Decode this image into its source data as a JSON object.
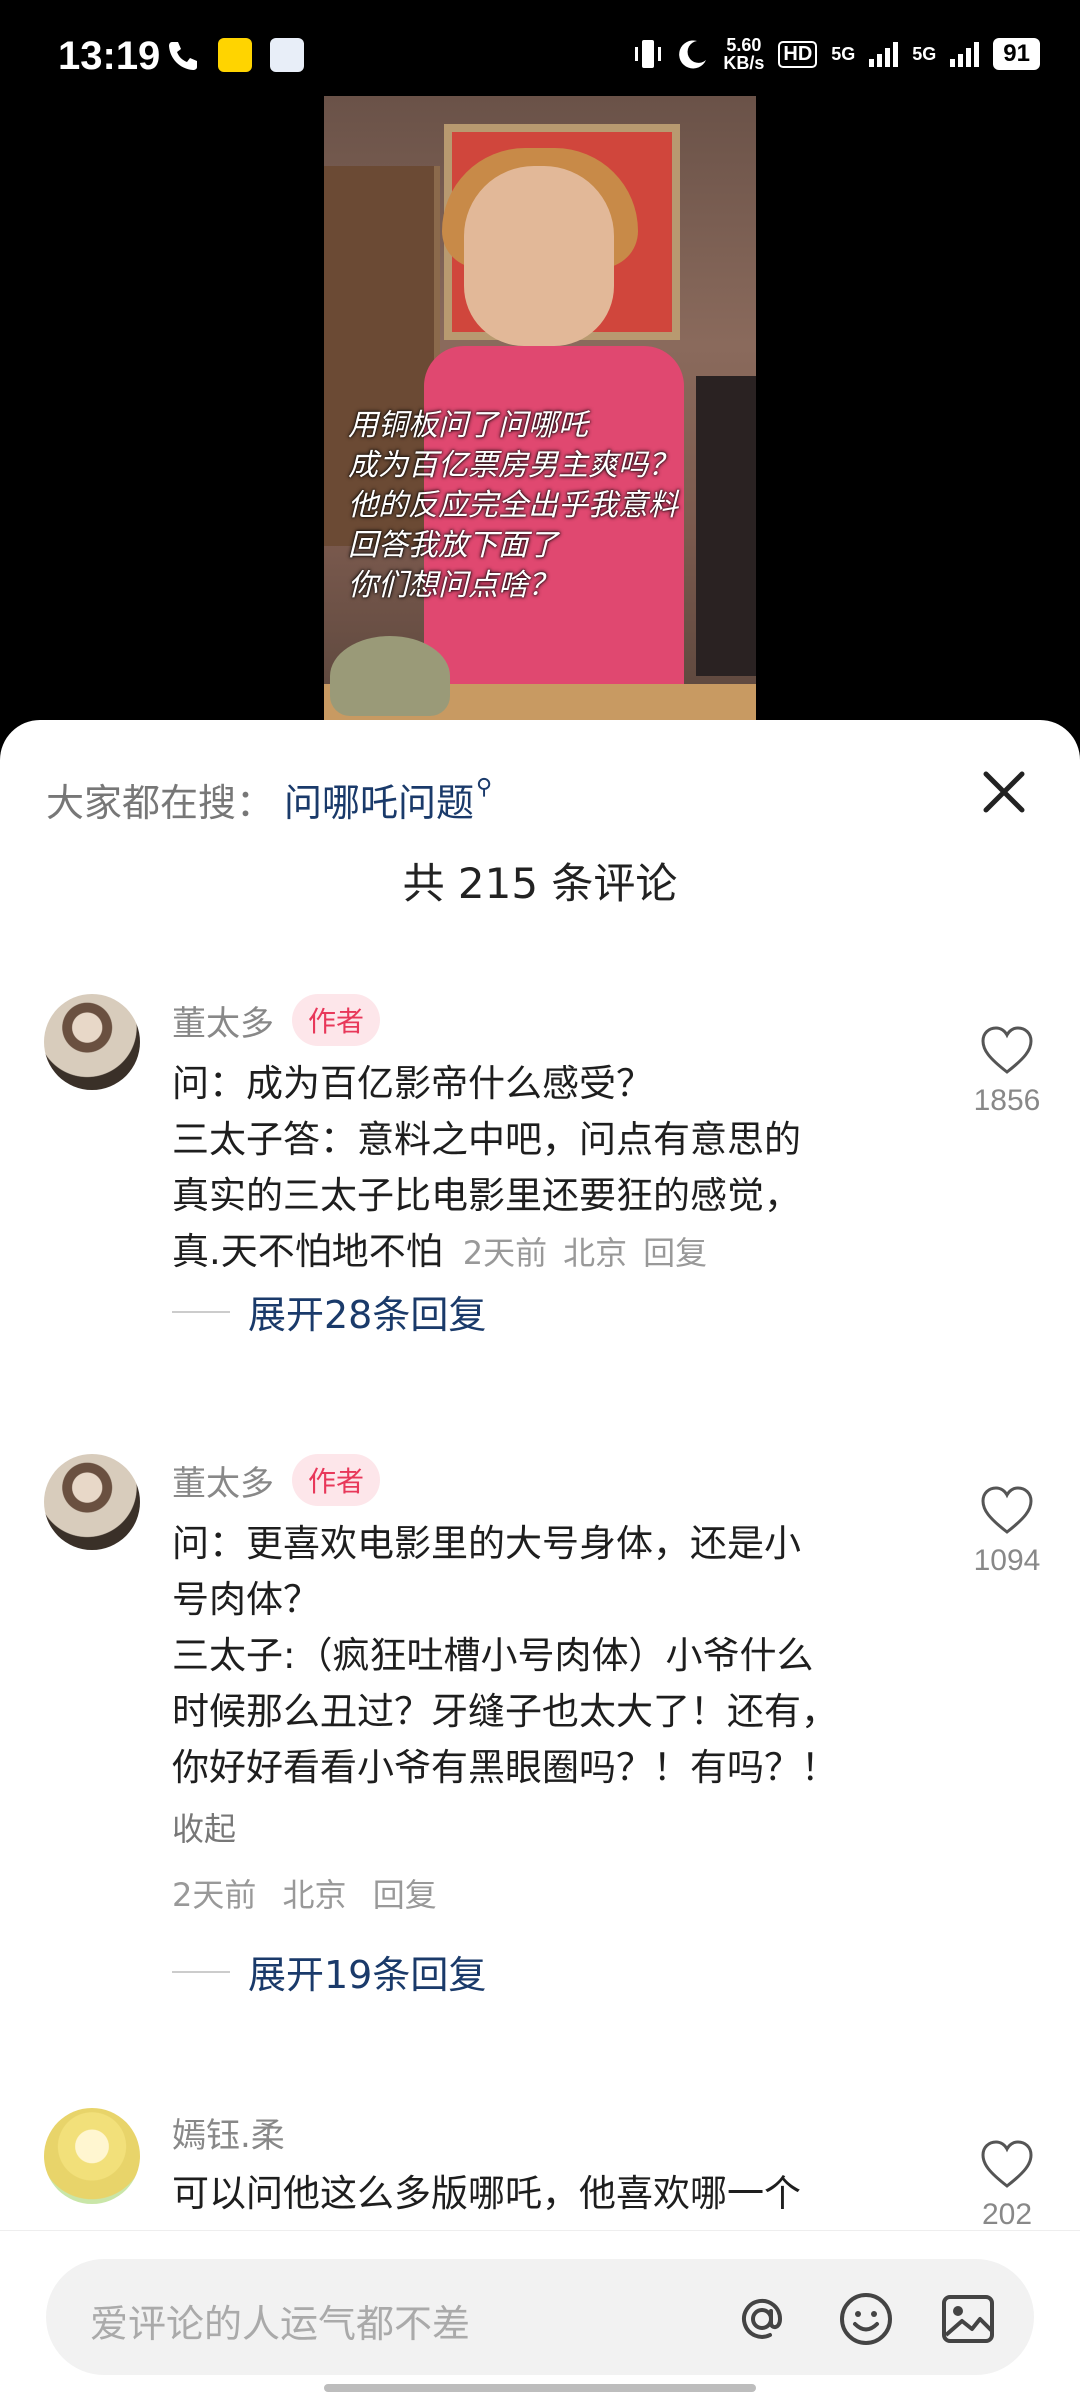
{
  "status_bar": {
    "time": "13:19",
    "net_speed_value": "5.60",
    "net_speed_unit": "KB/s",
    "hd_label": "HD",
    "signal1": "5G",
    "signal2": "5G",
    "battery": "91"
  },
  "video": {
    "caption": "用铜板问了问哪吒\n成为百亿票房男主爽吗？\n他的反应完全出乎我意料\n回答我放下面了\n你们想问点啥？"
  },
  "sheet": {
    "search_prefix": "大家都在搜：",
    "search_term": "问哪吒问题",
    "comment_count": "共 215 条评论"
  },
  "comments": [
    {
      "username": "董太多",
      "badge": "作者",
      "lines": [
        "问：成为百亿影帝什么感受？",
        "三太子答：意料之中吧，问点有意思的",
        "真实的三太子比电影里还要狂的感觉，",
        "真.天不怕地不怕"
      ],
      "time": "2天前",
      "location": "北京",
      "reply_label": "回复",
      "likes": "1856",
      "expand_label": "展开28条回复"
    },
    {
      "username": "董太多",
      "badge": "作者",
      "lines": [
        "问：更喜欢电影里的大号身体，还是小",
        "号肉体？",
        "三太子:（疯狂吐槽小号肉体）小爷什么",
        "时候那么丑过？牙缝子也太大了！还有，",
        "你好好看看小爷有黑眼圈吗？！有吗？！"
      ],
      "collapse_label": "收起",
      "time": "2天前",
      "location": "北京",
      "reply_label": "回复",
      "likes": "1094",
      "expand_label": "展开19条回复"
    },
    {
      "username": "嫣钰.柔",
      "lines": [
        "可以问他这么多版哪吒，他喜欢哪一个"
      ],
      "likes": "202"
    }
  ],
  "input_bar": {
    "placeholder": "爱评论的人运气都不差",
    "icons": [
      "at-icon",
      "emoji-icon",
      "image-icon"
    ]
  }
}
